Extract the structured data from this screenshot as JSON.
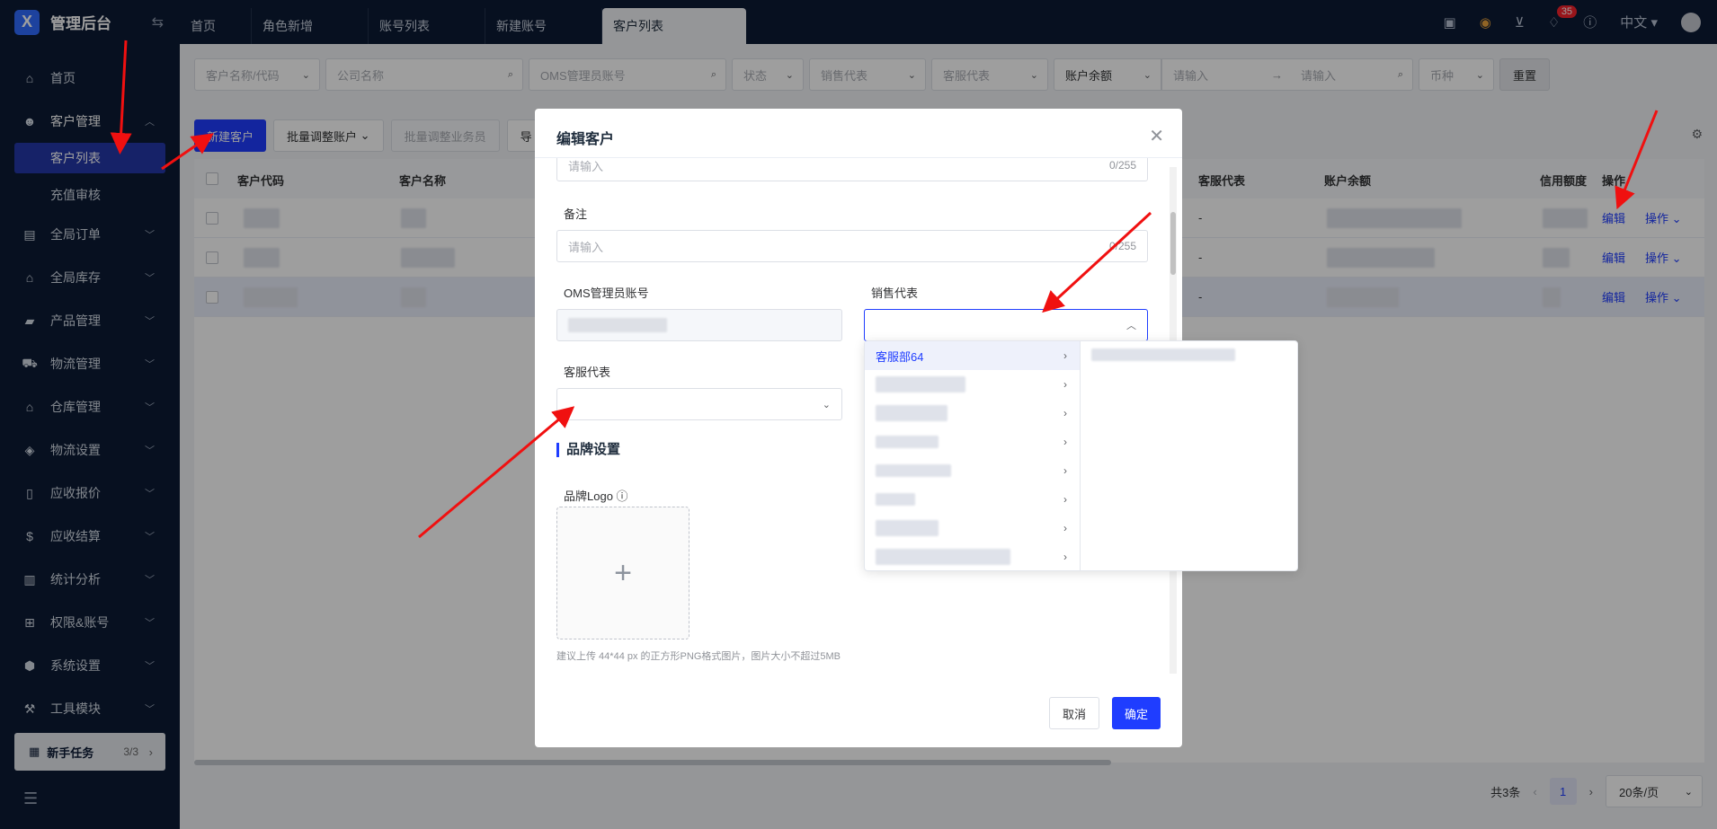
{
  "brand": {
    "name": "管理后台",
    "logo_letter": "X"
  },
  "tabs": [
    {
      "label": "首页"
    },
    {
      "label": "角色新增"
    },
    {
      "label": "账号列表"
    },
    {
      "label": "新建账号"
    },
    {
      "label": "客户列表"
    }
  ],
  "topbar": {
    "notifications": "35",
    "language": "中文"
  },
  "sidebar": {
    "items": [
      {
        "label": "首页",
        "icon": "home-icon"
      },
      {
        "label": "客户管理",
        "icon": "users-icon"
      },
      {
        "label": "全局订单",
        "icon": "order-icon"
      },
      {
        "label": "全局库存",
        "icon": "warehouse-icon"
      },
      {
        "label": "产品管理",
        "icon": "bag-icon"
      },
      {
        "label": "物流管理",
        "icon": "truck-icon"
      },
      {
        "label": "仓库管理",
        "icon": "storage-icon"
      },
      {
        "label": "物流设置",
        "icon": "box-icon"
      },
      {
        "label": "应收报价",
        "icon": "doc-icon"
      },
      {
        "label": "应收结算",
        "icon": "coin-icon"
      },
      {
        "label": "统计分析",
        "icon": "chart-icon"
      },
      {
        "label": "权限&账号",
        "icon": "org-icon"
      },
      {
        "label": "系统设置",
        "icon": "gear-icon"
      },
      {
        "label": "工具模块",
        "icon": "wrench-icon"
      }
    ],
    "sub_items": [
      "客户列表",
      "充值审核"
    ],
    "newbie": {
      "label": "新手任务",
      "progress": "3/3"
    }
  },
  "filters": {
    "customer": "客户名称/代码",
    "company": "公司名称",
    "oms": "OMS管理员账号",
    "status": "状态",
    "sales": "销售代表",
    "service": "客服代表",
    "balance": "账户余额",
    "min": "请输入",
    "max": "请输入",
    "currency": "币种",
    "reset": "重置"
  },
  "toolbar": {
    "new_customer": "新建客户",
    "batch_account": "批量调整账户",
    "batch_sales": "批量调整业务员",
    "more": "导"
  },
  "table": {
    "headers": [
      "客户代码",
      "客户名称",
      "客服代表",
      "账户余额",
      "信用额度",
      "操作"
    ],
    "rows": [
      {
        "service": "-",
        "edit": "编辑",
        "ops": "操作"
      },
      {
        "service": "-",
        "edit": "编辑",
        "ops": "操作"
      },
      {
        "service": "-",
        "edit": "编辑",
        "ops": "操作"
      }
    ]
  },
  "pager": {
    "total": "共3条",
    "page": "1",
    "size": "20条/页"
  },
  "dialog": {
    "title": "编辑客户",
    "top_input": {
      "placeholder": "请输入",
      "count": "0/255"
    },
    "remark": {
      "label": "备注",
      "placeholder": "请输入",
      "count": "0/255"
    },
    "oms_label": "OMS管理员账号",
    "sales_label": "销售代表",
    "service_label": "客服代表",
    "brand_section": "品牌设置",
    "logo_label": "品牌Logo",
    "hint": "建议上传 44*44 px 的正方形PNG格式图片，图片大小不超过5MB",
    "cancel": "取消",
    "confirm": "确定"
  },
  "cascader": {
    "first_option": "客服部64"
  },
  "colors": {
    "primary": "#1f3dff",
    "sidebar_bg": "#0c1b35",
    "arrow": "#f01010"
  }
}
